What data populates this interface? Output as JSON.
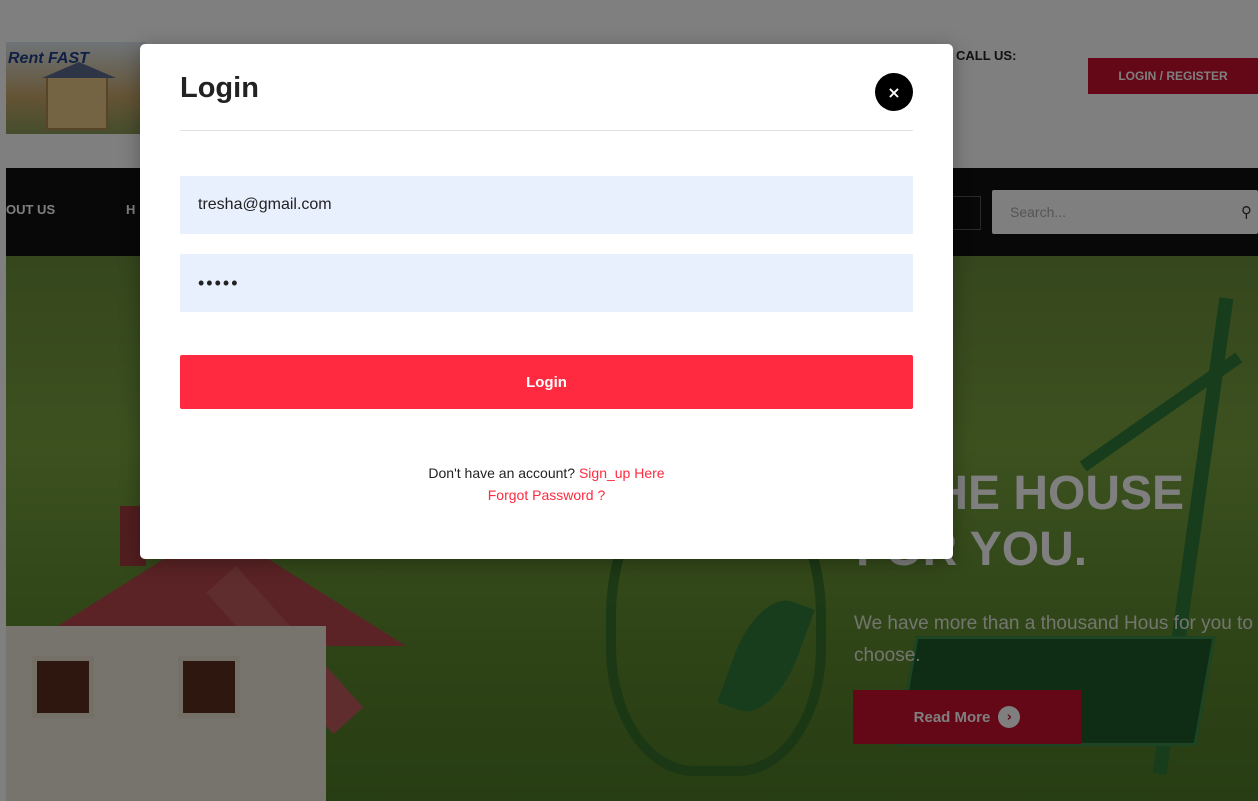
{
  "site": {
    "logo_text": "Rent FAST",
    "call_us": "CALL US:",
    "login_register_label": "LOGIN / REGISTER"
  },
  "nav": {
    "items": [
      "OUT US",
      "H"
    ],
    "search_placeholder": "Search..."
  },
  "hero": {
    "heading_line1": "D THE HOUSE",
    "heading_line2": "FOR YOU.",
    "subtext": "We have more than a thousand Hous for you to choose.",
    "read_more_label": "Read More"
  },
  "modal": {
    "title": "Login",
    "close_symbol": "×",
    "email_value": "tresha@gmail.com",
    "password_value": "•••••",
    "login_button_label": "Login",
    "no_account_text": "Don't have an account?",
    "signup_link": "Sign_up Here",
    "forgot_password_link": "Forgot Password ?"
  },
  "colors": {
    "accent_red": "#ff2a3f",
    "brand_red": "#c8102e",
    "input_bg": "#e8f0fe",
    "navbar_bg": "#111111"
  },
  "icons": {
    "close": "close-icon",
    "search": "search-icon",
    "read_more": "arrow-circle-icon"
  }
}
